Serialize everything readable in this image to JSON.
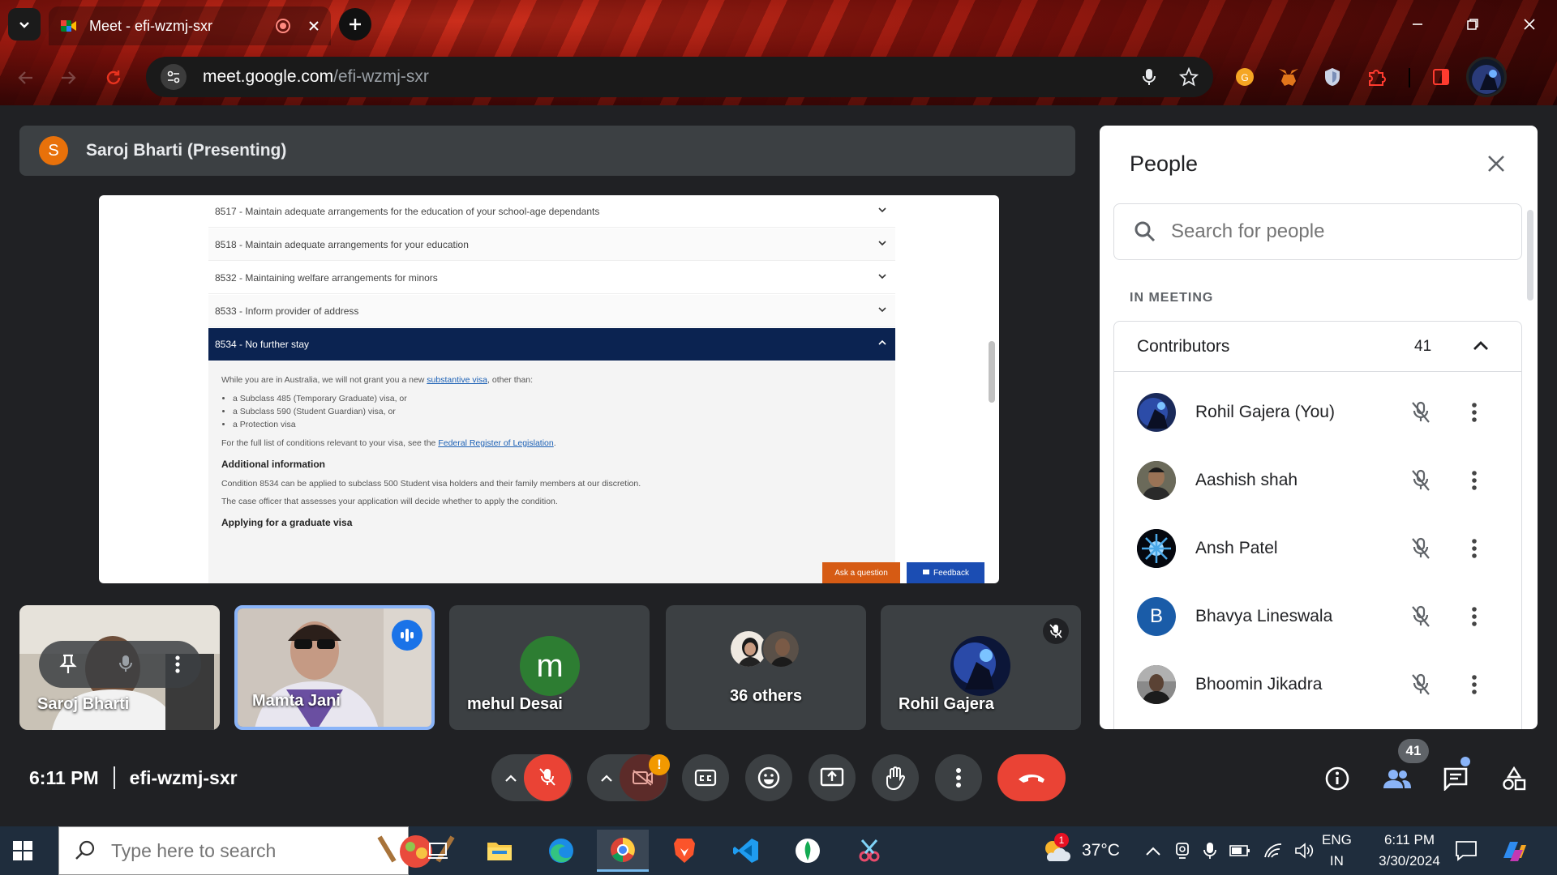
{
  "browser": {
    "tab_title": "Meet - efi-wzmj-sxr",
    "url_host": "meet.google.com",
    "url_path": "/efi-wzmj-sxr"
  },
  "presentation": {
    "avatar_letter": "S",
    "banner": "Saroj Bharti (Presenting)"
  },
  "shared_screen": {
    "rows": [
      "8517 - Maintain adequate arrangements for the education of your school-age dependants",
      "8518 - Maintain adequate arrangements for your education",
      "8532 - Maintaining welfare arrangements for minors",
      "8533 - Inform provider of address",
      "8534 - No further stay"
    ],
    "intro_pre": "While you are in Australia, we will not grant you a new ",
    "intro_link": "substantive visa",
    "intro_post": ", other than:",
    "bullets": [
      "a Subclass 485 (Temporary Graduate) visa, or",
      "a Subclass 590 (Student Guardian) visa, or",
      "a Protection visa"
    ],
    "conditions_pre": "For the full list of conditions relevant to your visa, see the ",
    "conditions_link": "Federal Register of Legislation",
    "conditions_post": ".",
    "additional_heading": "Additional information",
    "additional_p1": "Condition 8534 can be applied to subclass 500 Student visa holders and their family members at our discretion.",
    "additional_p2": "The case officer that assesses your application will decide whether to apply the condition.",
    "graduate_heading": "Applying for a graduate visa",
    "ask_button": "Ask a question",
    "feedback_button": "Feedback"
  },
  "tiles": [
    {
      "name": "Saroj Bharti"
    },
    {
      "name": "Mamta Jani"
    },
    {
      "name": "mehul Desai",
      "avatar_letter": "m"
    },
    {
      "name": "36 others"
    },
    {
      "name": "Rohil Gajera"
    }
  ],
  "footer": {
    "time": "6:11 PM",
    "meeting_code": "efi-wzmj-sxr",
    "people_badge": "41",
    "camera_alert": "!"
  },
  "people_panel": {
    "title": "People",
    "search_placeholder": "Search for people",
    "section": "IN MEETING",
    "group_label": "Contributors",
    "group_count": "41",
    "participants": [
      {
        "name": "Rohil Gajera (You)",
        "avatar_color": "#1a2a5a"
      },
      {
        "name": "Aashish shah",
        "avatar_color": "#4a4030"
      },
      {
        "name": "Ansh Patel",
        "avatar_color": "#0a1020"
      },
      {
        "name": "Bhavya Lineswala",
        "avatar_letter": "B",
        "avatar_color": "#1a5ca8"
      },
      {
        "name": "Bhoomin Jikadra",
        "avatar_color": "#3a3a3a"
      }
    ]
  },
  "taskbar": {
    "search_placeholder": "Type here to search",
    "weather_badge": "1",
    "temperature": "37°C",
    "language_1": "ENG",
    "language_2": "IN",
    "clock_time": "6:11 PM",
    "clock_date": "3/30/2024"
  },
  "colors": {
    "meet_bg": "#202124",
    "end_call": "#ea4335",
    "accent_blue": "#8ab4f8",
    "screen_header": "#0b2351"
  }
}
